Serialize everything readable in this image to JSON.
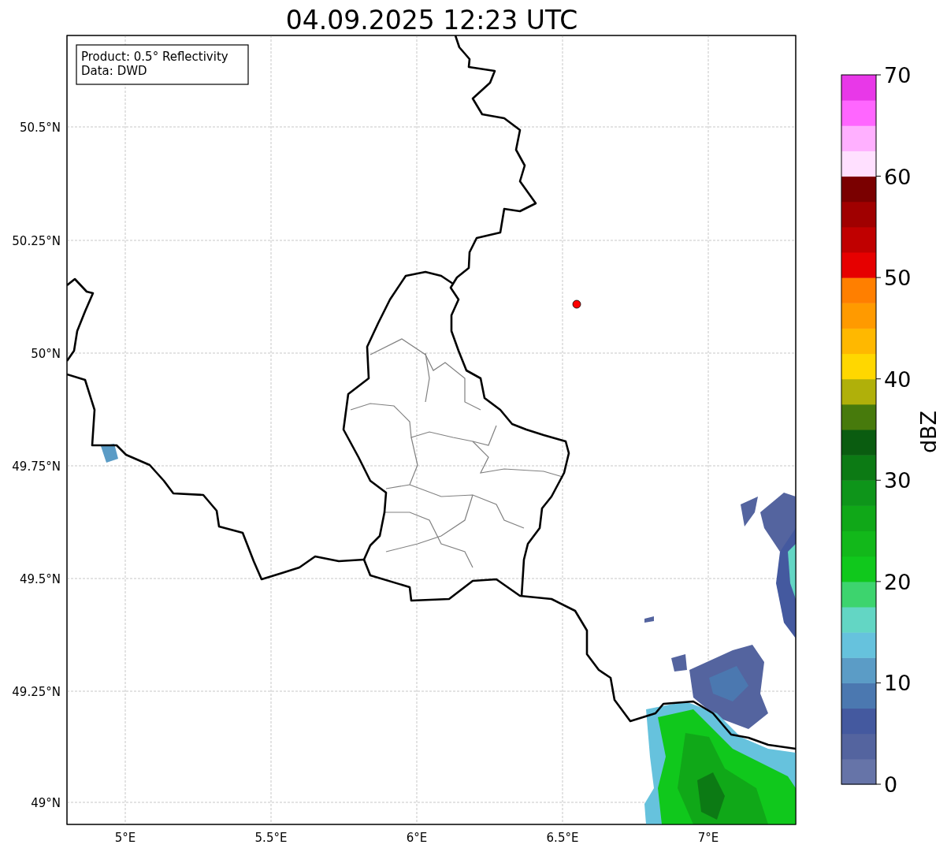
{
  "title": "04.09.2025 12:23 UTC",
  "info_box": [
    "Product: 0.5° Reflectivity",
    "Data: DWD"
  ],
  "y_ticks": [
    "50.5°N",
    "50.25°N",
    "50°N",
    "49.75°N",
    "49.5°N",
    "49.25°N",
    "49°N"
  ],
  "x_ticks": [
    "5°E",
    "5.5°E",
    "6°E",
    "6.5°E",
    "7°E"
  ],
  "colorbar": {
    "label": "dBZ",
    "ticks": [
      "70",
      "60",
      "50",
      "40",
      "30",
      "20",
      "10",
      "0"
    ],
    "segments": [
      {
        "color": "#6674a8"
      },
      {
        "color": "#54649f"
      },
      {
        "color": "#44599f"
      },
      {
        "color": "#4b78b0"
      },
      {
        "color": "#5b9cc6"
      },
      {
        "color": "#66c2dd"
      },
      {
        "color": "#63d6c4"
      },
      {
        "color": "#3dd46e"
      },
      {
        "color": "#10c81c"
      },
      {
        "color": "#12b81a"
      },
      {
        "color": "#10a818"
      },
      {
        "color": "#0e951a"
      },
      {
        "color": "#0c7a14"
      },
      {
        "color": "#0a5c10"
      },
      {
        "color": "#477a0c"
      },
      {
        "color": "#b0b00a"
      },
      {
        "color": "#ffd700"
      },
      {
        "color": "#ffb800"
      },
      {
        "color": "#ff9a00"
      },
      {
        "color": "#ff7f00"
      },
      {
        "color": "#e60000"
      },
      {
        "color": "#c00000"
      },
      {
        "color": "#a00000"
      },
      {
        "color": "#7a0000"
      },
      {
        "color": "#ffe0ff"
      },
      {
        "color": "#ffb0ff"
      },
      {
        "color": "#ff66ff"
      },
      {
        "color": "#e838e8"
      }
    ]
  }
}
